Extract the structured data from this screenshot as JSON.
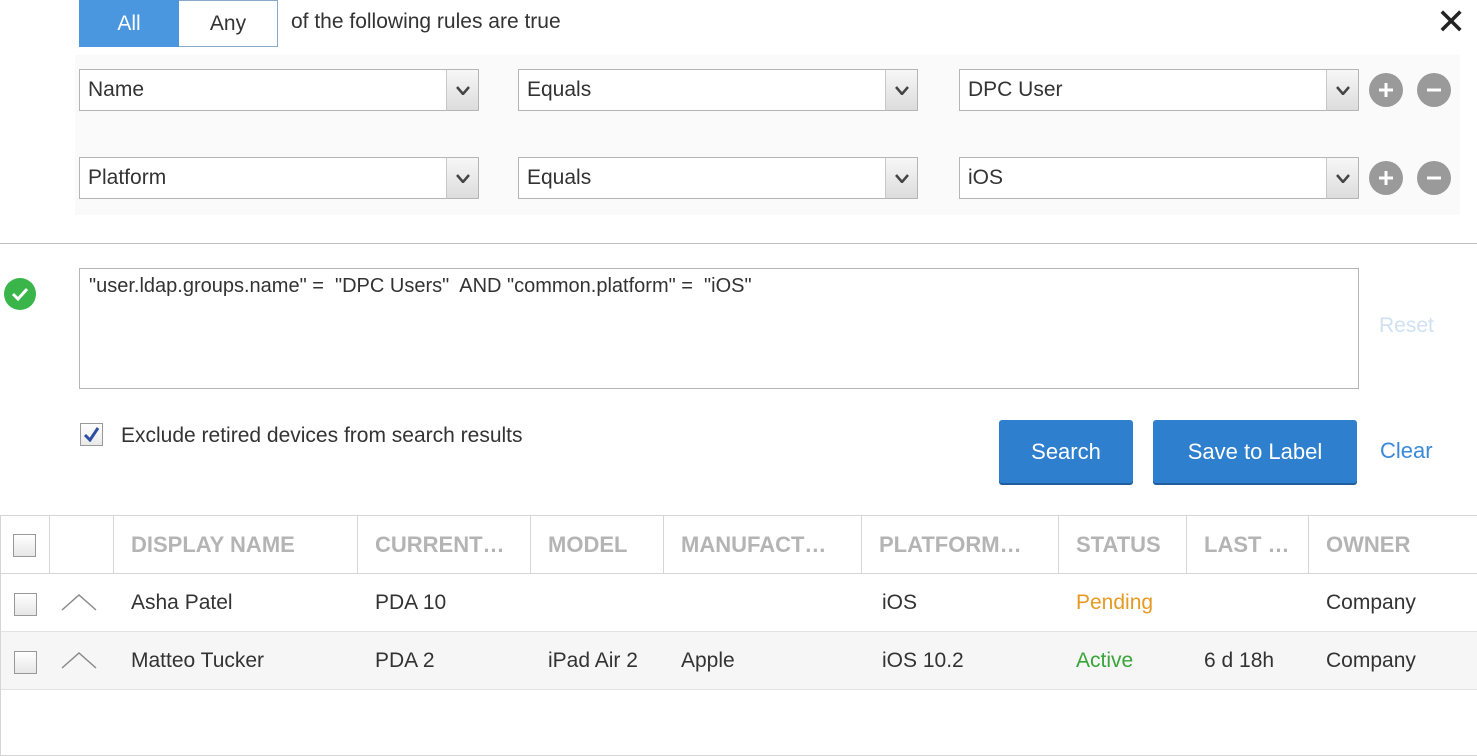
{
  "match_toggle": {
    "all_label": "All",
    "any_label": "Any",
    "selected": "All"
  },
  "rules_suffix": "of the following rules are true",
  "rules": [
    {
      "field": "Name",
      "operator": "Equals",
      "value": "DPC User"
    },
    {
      "field": "Platform",
      "operator": "Equals",
      "value": "iOS"
    }
  ],
  "query": {
    "text": "\"user.ldap.groups.name\" =  \"DPC Users\"  AND \"common.platform\" =  \"iOS\"",
    "valid": true
  },
  "reset_label": "Reset",
  "exclude_retired": {
    "label": "Exclude retired devices from search results",
    "checked": true
  },
  "buttons": {
    "search": "Search",
    "save_to_label": "Save to Label",
    "clear": "Clear"
  },
  "table": {
    "columns": [
      "DISPLAY NAME",
      "CURRENT…",
      "MODEL",
      "MANUFACT…",
      "PLATFORM…",
      "STATUS",
      "LAST …",
      "OWNER"
    ],
    "rows": [
      {
        "display_name": "Asha Patel",
        "current": "PDA 10",
        "model": "",
        "manufacturer": "",
        "platform": "iOS",
        "status": "Pending",
        "last": "",
        "owner": "Company"
      },
      {
        "display_name": "Matteo Tucker",
        "current": "PDA 2",
        "model": "iPad Air 2",
        "manufacturer": "Apple",
        "platform": "iOS 10.2",
        "status": "Active",
        "last": "6 d 18h",
        "owner": "Company"
      }
    ]
  },
  "colors": {
    "accent": "#4a97df",
    "button": "#2f7fcf",
    "pending": "#e69a22",
    "active": "#39a539",
    "ok": "#39b54a"
  },
  "icons": {
    "close": "close-icon",
    "add": "plus-icon",
    "remove": "minus-icon",
    "valid": "check-circle-icon",
    "expand": "chevron-up-icon"
  }
}
